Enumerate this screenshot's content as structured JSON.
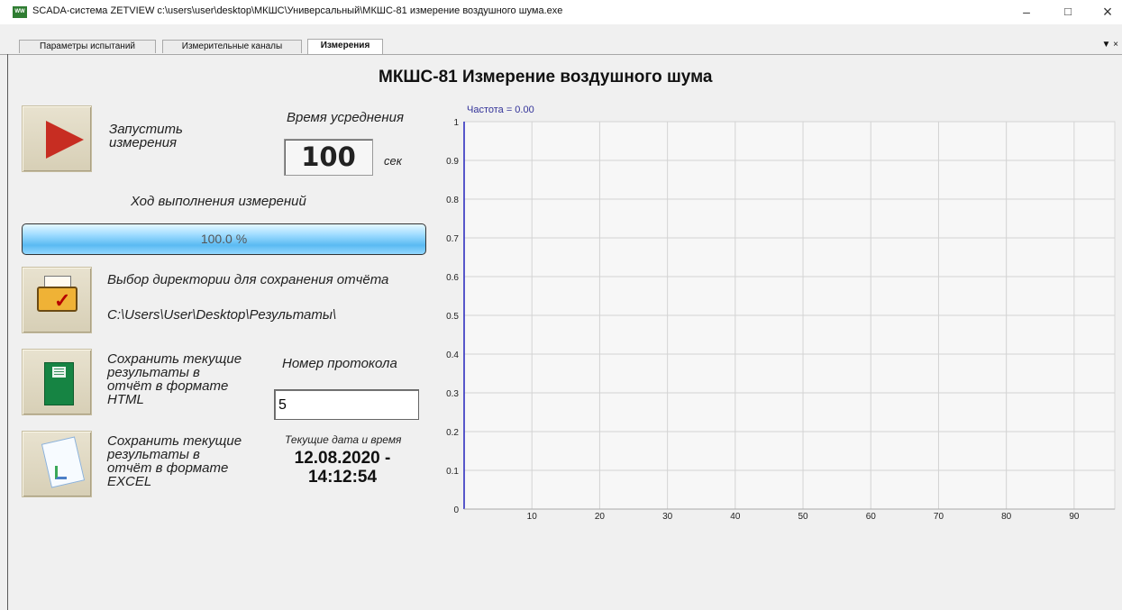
{
  "window": {
    "title": "SCADA-система ZETVIEW c:\\users\\user\\desktop\\МКШС\\Универсальный\\МКШС-81 измерение воздушного шума.exe",
    "app_icon_text": "WW",
    "minimize_symbol": "–",
    "maximize_symbol": "□",
    "close_symbol": "×"
  },
  "tabs": [
    {
      "label": "Параметры испытаний"
    },
    {
      "label": "Измерительные каналы"
    },
    {
      "label": "Измерения"
    }
  ],
  "tab_control": "▼ ×",
  "main": {
    "title": "МКШС-81 Измерение воздушного шума",
    "start_label": "Запустить\nизмерения",
    "averaging_label": "Время усреднения",
    "averaging_value": "100",
    "averaging_unit": "сек",
    "progress_label": "Ход выполнения измерений",
    "progress_text": "100.0 %",
    "progress_value": 100,
    "directory_label": "Выбор директории для сохранения отчёта",
    "directory_path": "C:\\Users\\User\\Desktop\\Результаты\\",
    "save_html_label": "Сохранить текущие\nрезультаты в\nотчёт в формате\nHTML",
    "protocol_label": "Номер протокола",
    "protocol_value": "5",
    "save_excel_label": "Сохранить текущие\nрезультаты в\nотчёт в формате\nEXCEL",
    "datetime_label": "Текущие дата и время",
    "datetime_value": "12.08.2020 -\n14:12:54"
  },
  "chart_data": {
    "type": "line",
    "annotation": "Частота = 0.00",
    "x_ticks": [
      "10",
      "20",
      "30",
      "40",
      "50",
      "60",
      "70",
      "80",
      "90"
    ],
    "y_ticks": [
      "0",
      "0.1",
      "0.2",
      "0.3",
      "0.4",
      "0.5",
      "0.6",
      "0.7",
      "0.8",
      "0.9",
      "1"
    ],
    "xlim": [
      0,
      96
    ],
    "ylim": [
      0,
      1
    ],
    "grid": true,
    "series": [
      {
        "values": []
      }
    ],
    "colors": {
      "axis": "#3030c0",
      "grid": "#d3d3d3"
    }
  }
}
